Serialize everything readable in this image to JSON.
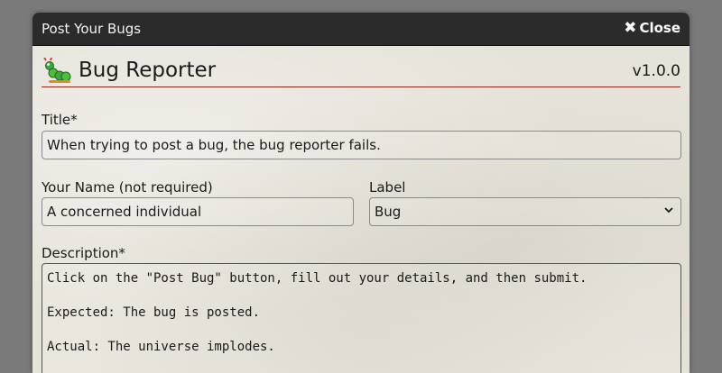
{
  "window": {
    "title": "Post Your Bugs",
    "close_label": "Close",
    "close_icon": "close-x-icon"
  },
  "header": {
    "icon": "caterpillar-bug-icon",
    "title": "Bug Reporter",
    "version": "v1.0.0"
  },
  "form": {
    "title_label": "Title*",
    "title_value": "When trying to post a bug, the bug reporter fails.",
    "name_label": "Your Name (not required)",
    "name_value": "A concerned individual",
    "label_label": "Label",
    "label_value": "Bug",
    "description_label": "Description*",
    "description_value": "Click on the \"Post Bug\" button, fill out your details, and then submit.\n\nExpected: The bug is posted.\n\nActual: The universe implodes."
  },
  "colors": {
    "titlebar": "#2b2b2b",
    "header_rule": "#8b2a1a",
    "backdrop": "#7a7a7a"
  }
}
